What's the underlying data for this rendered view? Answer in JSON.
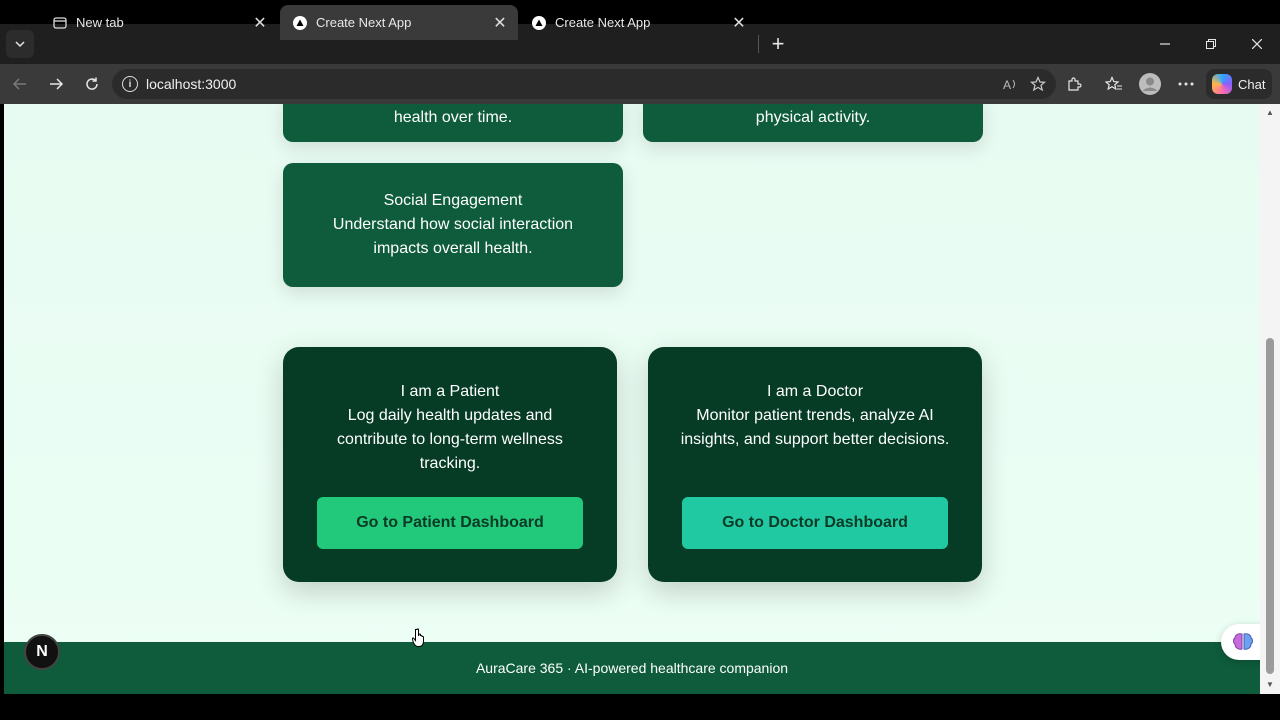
{
  "browser": {
    "tabs": [
      {
        "label": "New tab",
        "close": "✕"
      },
      {
        "label": "Create Next App",
        "close": "✕"
      },
      {
        "label": "Create Next App",
        "close": "✕"
      }
    ],
    "new_tab": "+",
    "url": "localhost:3000",
    "chat_label": "Chat",
    "window_controls": {
      "minimize": "—",
      "restore": "❐",
      "close": "✕"
    }
  },
  "features": {
    "top_left_partial": "health over time.",
    "top_right_partial": "physical activity.",
    "social": {
      "title": "Social Engagement",
      "desc": "Understand how social interaction impacts overall health."
    }
  },
  "roles": {
    "patient": {
      "title": "I am a Patient",
      "desc": "Log daily health updates and contribute to long-term wellness tracking.",
      "button": "Go to Patient Dashboard",
      "button_color": "#22c97a"
    },
    "doctor": {
      "title": "I am a Doctor",
      "desc": "Monitor patient trends, analyze AI insights, and support better decisions.",
      "button": "Go to Doctor Dashboard",
      "button_color": "#21c9a3"
    }
  },
  "footer": {
    "text": "AuraCare 365 · AI-powered healthcare companion"
  },
  "badge": {
    "label": "N"
  },
  "colors": {
    "accent_dark": "#063b26",
    "accent": "#0e5c3c",
    "background": "#e8fbf2"
  }
}
